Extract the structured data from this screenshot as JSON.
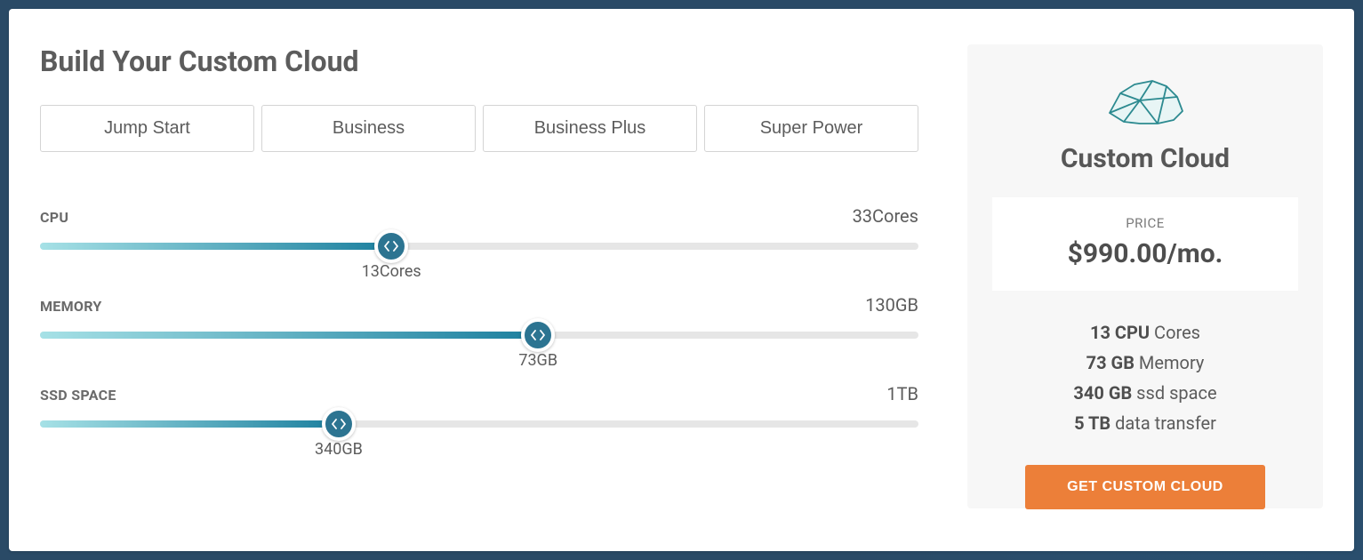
{
  "title": "Build Your Custom Cloud",
  "tabs": [
    {
      "label": "Jump Start"
    },
    {
      "label": "Business"
    },
    {
      "label": "Business Plus"
    },
    {
      "label": "Super Power"
    }
  ],
  "sliders": {
    "cpu": {
      "label": "CPU",
      "max_label": "33Cores",
      "value_label": "13Cores",
      "value": 13,
      "max": 33,
      "percent": 40
    },
    "memory": {
      "label": "MEMORY",
      "max_label": "130GB",
      "value_label": "73GB",
      "value": 73,
      "max": 130,
      "percent": 56.7
    },
    "ssd": {
      "label": "SSD SPACE",
      "max_label": "1TB",
      "value_label": "340GB",
      "value": 340,
      "max": 1000,
      "percent": 34
    }
  },
  "summary": {
    "plan_name": "Custom Cloud",
    "price_label": "PRICE",
    "price_value": "$990.00/mo.",
    "specs": {
      "cpu_bold": "13 CPU",
      "cpu_rest": " Cores",
      "mem_bold": "73 GB",
      "mem_rest": " Memory",
      "ssd_bold": "340 GB",
      "ssd_rest": " ssd space",
      "data_bold": "5 TB",
      "data_rest": " data transfer"
    },
    "cta_label": "GET CUSTOM CLOUD"
  },
  "colors": {
    "accent": "#2c7491",
    "cta": "#ec7f39"
  }
}
